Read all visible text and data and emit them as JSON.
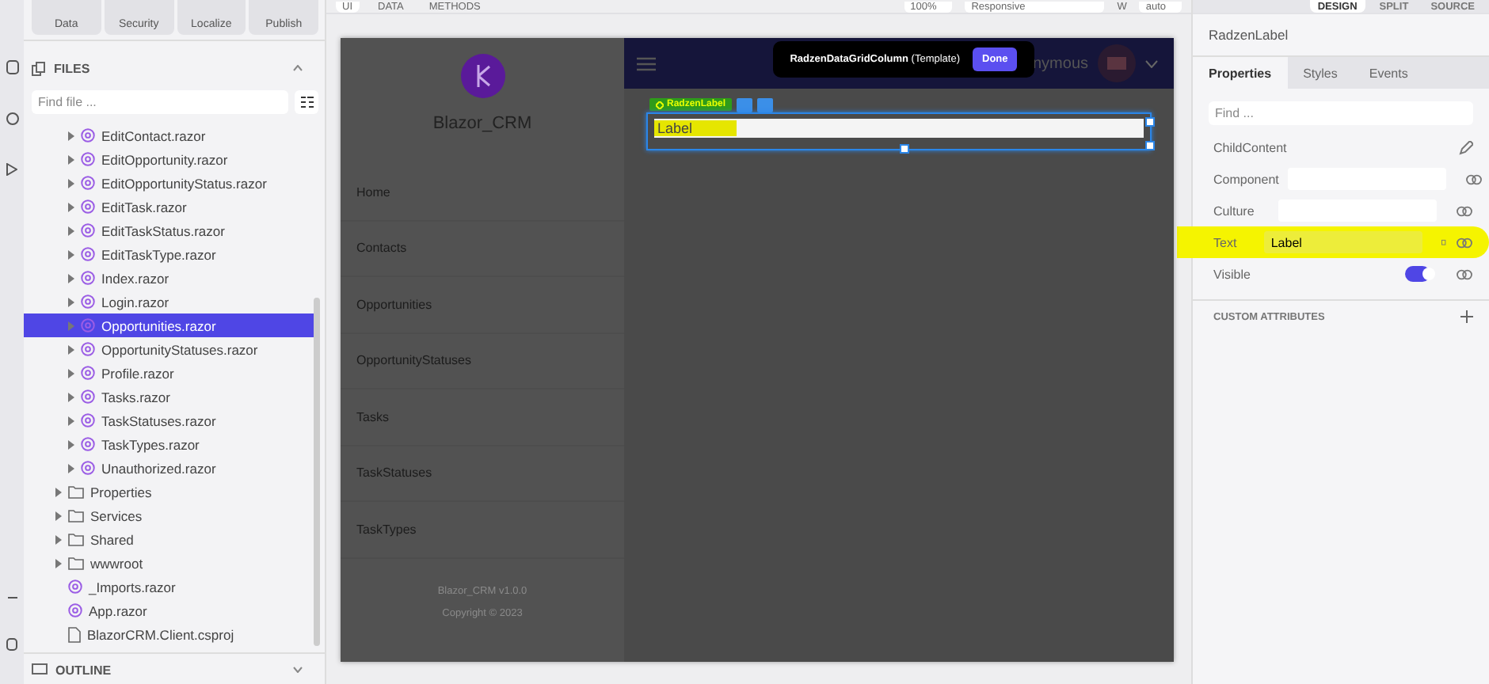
{
  "toolbar": {
    "actions": [
      {
        "label": "Data"
      },
      {
        "label": "Security"
      },
      {
        "label": "Localize"
      },
      {
        "label": "Publish"
      }
    ],
    "view_tabs": [
      {
        "label": "UI",
        "selected": true
      },
      {
        "label": "DATA",
        "selected": false
      },
      {
        "label": "METHODS",
        "selected": false
      }
    ],
    "zoom": "100%",
    "device": "Responsive",
    "width_label": "W",
    "width": "auto",
    "modes": [
      {
        "label": "DESIGN",
        "selected": true
      },
      {
        "label": "SPLIT",
        "selected": false
      },
      {
        "label": "SOURCE",
        "selected": false
      }
    ]
  },
  "files": {
    "title": "FILES",
    "search": {
      "placeholder": "Find file ..."
    },
    "tree": [
      {
        "kind": "group",
        "children": [
          {
            "kind": "razor-page",
            "name": "EditContact.razor",
            "selected": false
          },
          {
            "kind": "razor-page",
            "name": "EditOpportunity.razor",
            "selected": false
          },
          {
            "kind": "razor-page",
            "name": "EditOpportunityStatus.razor",
            "selected": false
          },
          {
            "kind": "razor-page",
            "name": "EditTask.razor",
            "selected": false
          },
          {
            "kind": "razor-page",
            "name": "EditTaskStatus.razor",
            "selected": false
          },
          {
            "kind": "razor-page",
            "name": "EditTaskType.razor",
            "selected": false
          },
          {
            "kind": "razor-page",
            "name": "Index.razor",
            "selected": false
          },
          {
            "kind": "razor-page",
            "name": "Login.razor",
            "selected": false
          },
          {
            "kind": "razor-page",
            "name": "Opportunities.razor",
            "selected": true
          },
          {
            "kind": "razor-page",
            "name": "OpportunityStatuses.razor",
            "selected": false
          },
          {
            "kind": "razor-page",
            "name": "Profile.razor",
            "selected": false
          },
          {
            "kind": "razor-page",
            "name": "Tasks.razor",
            "selected": false
          },
          {
            "kind": "razor-page",
            "name": "TaskStatuses.razor",
            "selected": false
          },
          {
            "kind": "razor-page",
            "name": "TaskTypes.razor",
            "selected": false
          },
          {
            "kind": "razor-page",
            "name": "Unauthorized.razor",
            "selected": false
          }
        ]
      },
      {
        "kind": "folder",
        "name": "Properties",
        "selected": false
      },
      {
        "kind": "folder",
        "name": "Services",
        "selected": false
      },
      {
        "kind": "folder",
        "name": "Shared",
        "selected": false
      },
      {
        "kind": "folder",
        "name": "wwwroot",
        "selected": false
      },
      {
        "kind": "razor",
        "name": "_Imports.razor",
        "selected": false
      },
      {
        "kind": "razor",
        "name": "App.razor",
        "selected": false
      },
      {
        "kind": "file",
        "name": "BlazorCRM.Client.csproj",
        "selected": false
      }
    ]
  },
  "outline": {
    "title": "OUTLINE"
  },
  "preview": {
    "brand": "Blazor_CRM",
    "nav": [
      "Home",
      "Contacts",
      "Opportunities",
      "OpportunityStatuses",
      "Tasks",
      "TaskStatuses",
      "TaskTypes"
    ],
    "footer": [
      "Blazor_CRM v1.0.0",
      "Copyright © 2023"
    ],
    "user": "nymous",
    "popup": {
      "title": "RadzenDataGridColumn",
      "subtitle": "(Template)",
      "button": "Done"
    },
    "selection": {
      "tag": "RadzenLabel"
    },
    "label": {
      "text": "Label",
      "highlighted": true
    }
  },
  "inspector": {
    "title": "RadzenLabel",
    "tabs": [
      {
        "label": "Properties",
        "selected": true
      },
      {
        "label": "Styles",
        "selected": false
      },
      {
        "label": "Events",
        "selected": false
      }
    ],
    "search": {
      "placeholder": "Find ..."
    },
    "properties": [
      {
        "kind": "editor",
        "name": "ChildContent",
        "highlighted": false
      },
      {
        "kind": "input",
        "name": "Component",
        "highlighted": false
      },
      {
        "kind": "input",
        "name": "Culture",
        "highlighted": false
      },
      {
        "kind": "input",
        "name": "Text",
        "value": "Label",
        "highlighted": true
      },
      {
        "kind": "toggle",
        "name": "Visible",
        "on": true,
        "highlighted": false
      }
    ],
    "custom_attributes": "CUSTOM ATTRIBUTES"
  }
}
